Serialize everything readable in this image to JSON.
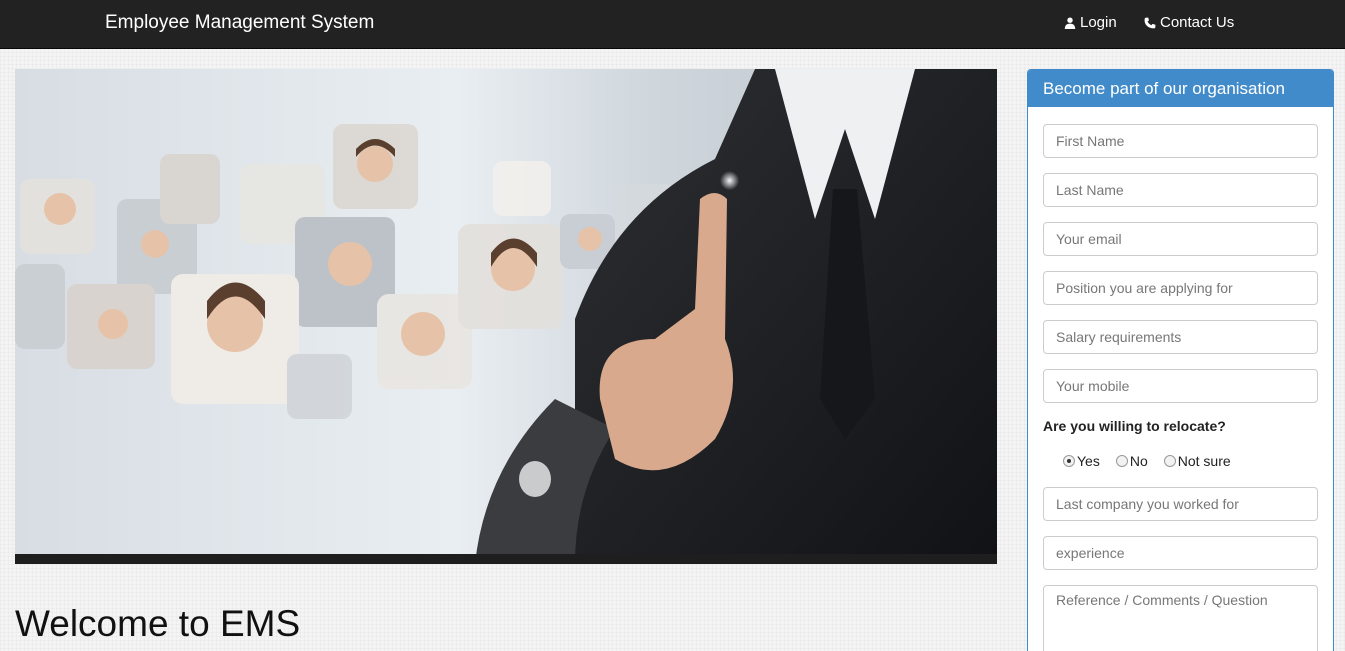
{
  "navbar": {
    "brand": "Employee Management System",
    "login": "Login",
    "contact": "Contact Us",
    "login_icon": "user-icon",
    "contact_icon": "phone-icon"
  },
  "main": {
    "welcome": "Welcome to EMS"
  },
  "form": {
    "title": "Become part of our organisation",
    "first_name": "First Name",
    "last_name": "Last Name",
    "email": "Your email",
    "position": "Position you are applying for",
    "salary": "Salary requirements",
    "mobile": "Your mobile",
    "relocate_question": "Are you willing to relocate?",
    "relocate_options": [
      "Yes",
      "No",
      "Not sure"
    ],
    "relocate_selected": "Yes",
    "last_company": "Last company you worked for",
    "experience": "experience",
    "comments": "Reference / Comments / Question"
  },
  "colors": {
    "navbar_bg": "#222222",
    "panel_accent": "#428bca"
  }
}
